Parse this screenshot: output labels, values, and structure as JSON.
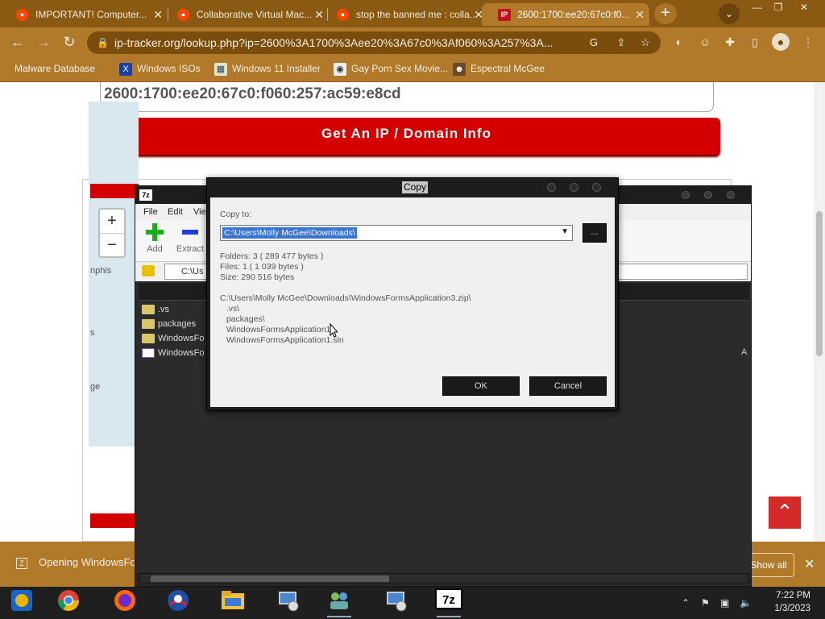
{
  "browser": {
    "tabs": [
      {
        "title": "IMPORTANT! Computer...",
        "favicon": "reddit-icon",
        "active": false
      },
      {
        "title": "Collaborative Virtual Mac...",
        "favicon": "reddit-icon",
        "active": false
      },
      {
        "title": "stop the banned me : colla...",
        "favicon": "reddit-icon",
        "active": false
      },
      {
        "title": "2600:1700:ee20:67c0:f0...",
        "favicon": "ip-icon",
        "active": true
      }
    ],
    "url": "ip-tracker.org/lookup.php?ip=2600%3A1700%3Aee20%3A67c0%3Af060%3A257%3A...",
    "bookmarks": [
      {
        "label": "Malware Database",
        "icon": "folder-icon"
      },
      {
        "label": "Windows ISOs",
        "icon": "x-icon"
      },
      {
        "label": "Windows 11 Installer",
        "icon": "image-icon"
      },
      {
        "label": "Gay Porn Sex Movie...",
        "icon": "site-icon"
      },
      {
        "label": "Espectral McGee",
        "icon": "avatar-icon"
      }
    ]
  },
  "page": {
    "ip_value": "2600:1700:ee20:67c0:f060:257:ac59:e8cd",
    "get_button": "Get An IP / Domain Info",
    "map_labels": {
      "memphis": "nphis",
      "e_label": "ge",
      "s_label": "s"
    },
    "zoom_in": "+",
    "zoom_out": "−"
  },
  "sevenzip": {
    "title_logo": "7z",
    "menu": [
      "File",
      "Edit",
      "Vie"
    ],
    "tools": {
      "add": "Add",
      "extract": "Extract"
    },
    "address": "C:\\Us",
    "files": [
      {
        "name": ".vs",
        "type": "folder"
      },
      {
        "name": "packages",
        "type": "folder"
      },
      {
        "name": "WindowsFo",
        "type": "folder"
      },
      {
        "name": "WindowsFo",
        "type": "sln"
      }
    ],
    "side_letter": "A"
  },
  "copy_dialog": {
    "title": "Copy",
    "copy_to_label": "Copy to:",
    "destination": "C:\\Users\\Molly McGee\\Downloads\\",
    "browse": "...",
    "folders": "Folders: 3    ( 289 477 bytes )",
    "files": "Files: 1     ( 1 039 bytes )",
    "size": "Size:  290 516 bytes",
    "paths": [
      "C:\\Users\\Molly McGee\\Downloads\\WindowsFormsApplication3.zip\\",
      "  .vs\\",
      "  packages\\",
      "  WindowsFormsApplication1\\",
      "  WindowsFormsApplication1.sln"
    ],
    "ok": "OK",
    "cancel": "Cancel"
  },
  "notification": {
    "text": "Opening WindowsFor",
    "show_all": "Show all"
  },
  "taskbar": {
    "time": "7:22 PM",
    "date": "1/3/2023"
  },
  "colors": {
    "accent_red": "#d40000",
    "chrome_brown": "#b07a2a",
    "dialog_dark": "#1d1d1d"
  }
}
